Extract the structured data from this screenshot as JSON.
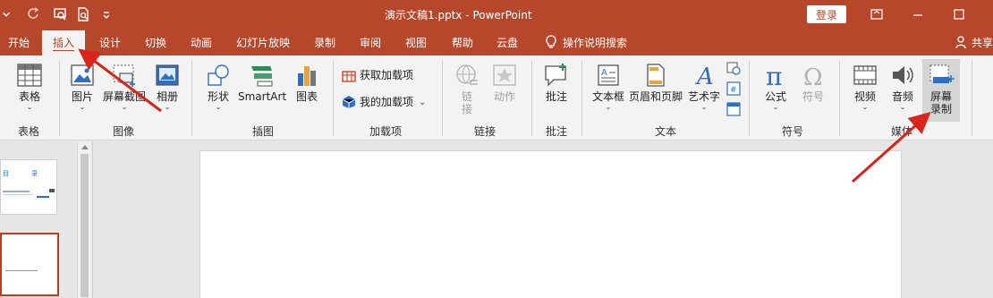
{
  "titlebar": {
    "doc_title": "演示文稿1.pptx  -  PowerPoint",
    "login": "登录",
    "qa_icons": [
      "undo-dropdown-icon",
      "redo-icon",
      "present-from-start-icon",
      "print-preview-icon",
      "customize-icon"
    ]
  },
  "tabs": [
    "开始",
    "插入",
    "设计",
    "切换",
    "动画",
    "幻灯片放映",
    "录制",
    "审阅",
    "视图",
    "帮助",
    "云盘",
    "操作说明搜索",
    "共享"
  ],
  "active_tab": "插入",
  "ribbon": {
    "table": "表格",
    "picture": "图片",
    "screenshot": "屏幕截图",
    "album": "相册",
    "shapes": "形状",
    "smartart": "SmartArt",
    "chart": "图表",
    "get_addins": "获取加载项",
    "my_addins": "我的加载项",
    "link_1": "链",
    "link_2": "接",
    "action": "动作",
    "comment": "批注",
    "textbox": "文本框",
    "header_footer": "页眉和页脚",
    "wordart": "艺术字",
    "equation": "公式",
    "symbol": "符号",
    "video": "视频",
    "audio": "音频",
    "screen_rec_1": "屏幕",
    "screen_rec_2": "录制"
  },
  "groups": {
    "table": "表格",
    "images": "图像",
    "illustrations": "插图",
    "addins": "加载项",
    "links": "链接",
    "comments": "批注",
    "text": "文本",
    "symbols": "符号",
    "media": "媒体"
  },
  "thumbnail": {
    "text_a": "目",
    "text_b": "录"
  },
  "colors": {
    "accent": "#b7472a",
    "ribbon_bg": "#f3f3f3",
    "workspace_bg": "#e6e6e6",
    "annotation_arrow": "#d9231b"
  }
}
